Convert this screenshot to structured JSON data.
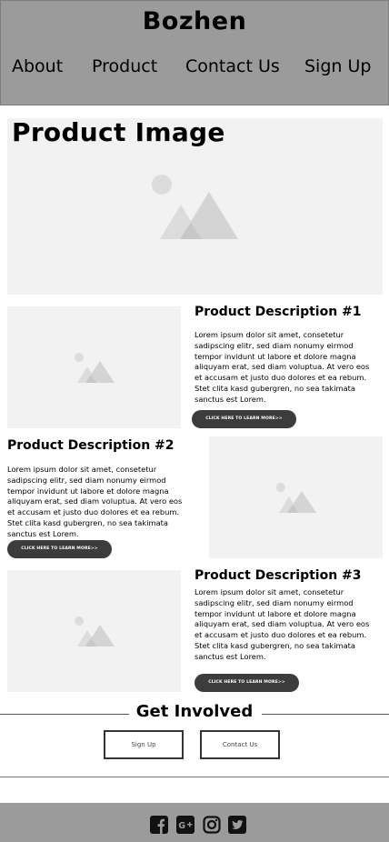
{
  "brand": "Bozhen",
  "nav": {
    "about": "About",
    "product": "Product",
    "contact": "Contact Us",
    "signup": "Sign Up"
  },
  "hero": {
    "title": "Product Image"
  },
  "products": [
    {
      "title": "Product Description #1",
      "text": "Lorem ipsum dolor sit amet, consetetur sadipscing elitr, sed diam nonumy eirmod tempor invidunt ut labore et dolore magna aliquyam erat, sed diam voluptua. At vero eos et accusam et justo duo dolores et ea rebum. Stet clita kasd gubergren, no sea takimata sanctus est Lorem.",
      "cta": "CLICK HERE TO LEARN MORE>>"
    },
    {
      "title": "Product Description #2",
      "text": "Lorem ipsum dolor sit amet, consetetur sadipscing elitr, sed diam nonumy eirmod tempor invidunt ut labore et dolore magna aliquyam erat, sed diam voluptua. At vero eos et accusam et justo duo dolores et ea rebum. Stet clita kasd gubergren, no sea takimata sanctus est Lorem.",
      "cta": "CLICK HERE TO LEARN MORE>>"
    },
    {
      "title": "Product Description #3",
      "text": "Lorem ipsum dolor sit amet, consetetur sadipscing elitr, sed diam nonumy eirmod tempor invidunt ut labore et dolore magna aliquyam erat, sed diam voluptua. At vero eos et accusam et justo duo dolores et ea rebum. Stet clita kasd gubergren, no sea takimata sanctus est Lorem.",
      "cta": "CLICK HERE TO LEARN MORE>>"
    }
  ],
  "get_involved": {
    "title": "Get Involved",
    "signup_label": "Sign Up",
    "contact_label": "Contact Us"
  },
  "footer": {
    "social": [
      "facebook-icon",
      "google-plus-icon",
      "instagram-icon",
      "twitter-icon"
    ]
  },
  "colors": {
    "header_bg": "#9b9b9b",
    "placeholder_bg": "#f2f2f2",
    "placeholder_shape": "#dcdcdc",
    "button_dark": "#3c3c3c"
  }
}
